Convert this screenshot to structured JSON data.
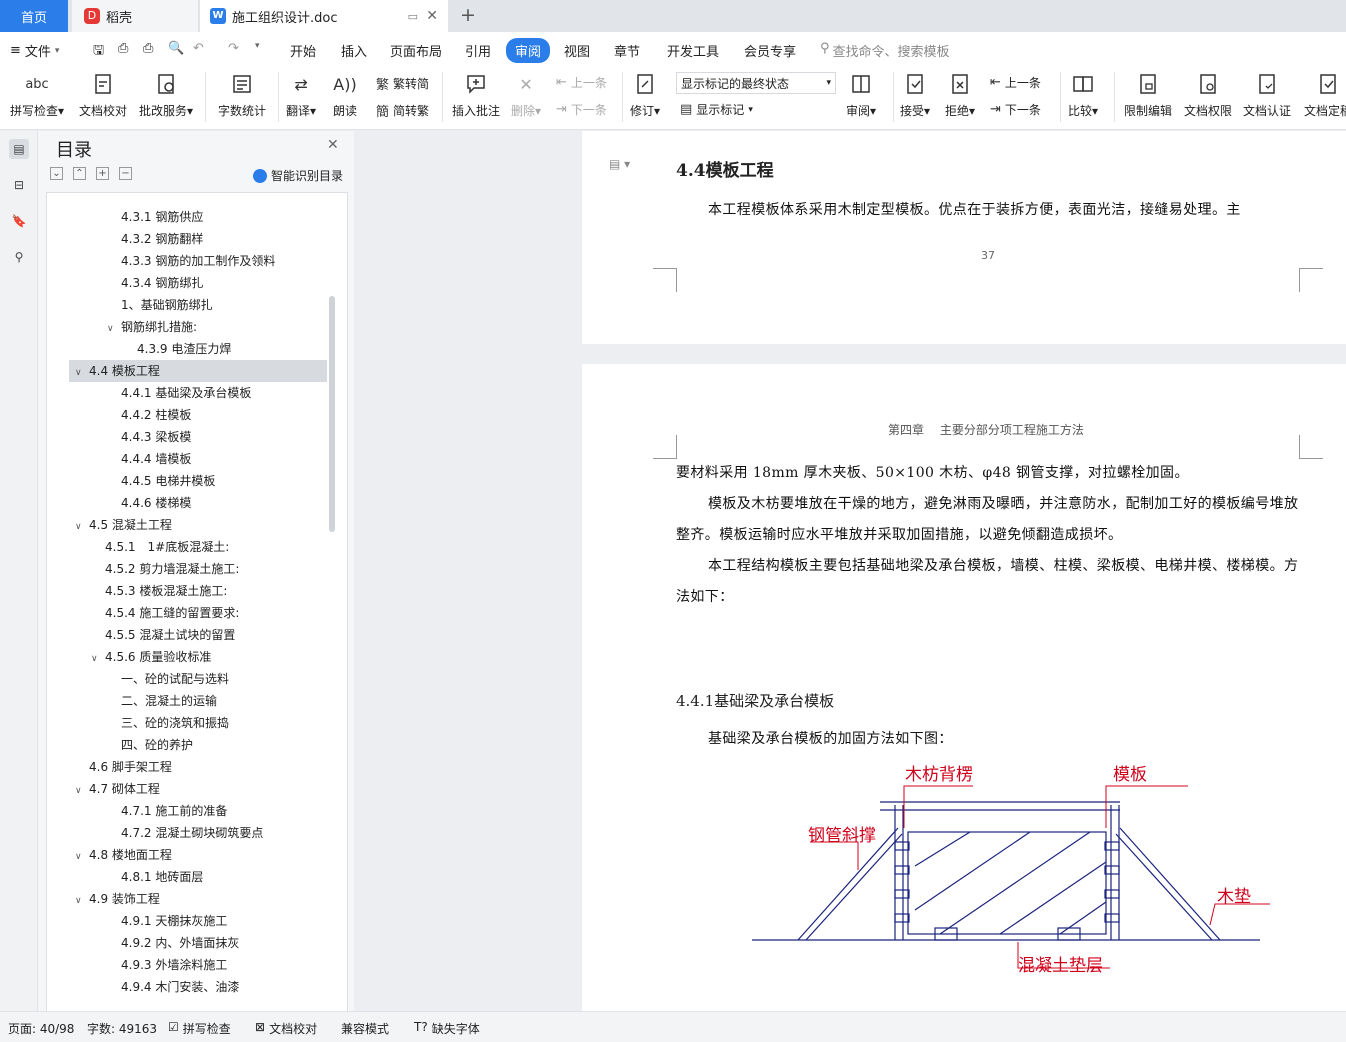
{
  "tabs": {
    "home": "首页",
    "daoke": "稻壳",
    "doc": "施工组织设计.doc",
    "new_tab": "+"
  },
  "menu": {
    "file": "文件",
    "items": [
      "开始",
      "插入",
      "页面布局",
      "引用",
      "审阅",
      "视图",
      "章节",
      "开发工具",
      "会员专享"
    ],
    "active": "审阅",
    "search": "查找命令、搜索模板"
  },
  "toolbar": {
    "spell": "拼写检查",
    "proof": "文档校对",
    "batch": "批改服务",
    "wordcount": "字数统计",
    "translate": "翻译",
    "read": "朗读",
    "t2s": "繁转简",
    "s2t": "简转繁",
    "add_comment": "插入批注",
    "delete": "删除",
    "prev_comment": "上一条",
    "next_comment": "下一条",
    "revise": "修订",
    "markup_state": "显示标记的最终状态",
    "show_markup": "显示标记",
    "review": "审阅",
    "accept": "接受",
    "reject": "拒绝",
    "prev": "上一条",
    "next": "下一条",
    "compare": "比较",
    "restrict": "限制编辑",
    "permission": "文档权限",
    "certify": "文档认证",
    "finalize": "文档定稿",
    "spell_icon_text": "abc"
  },
  "toc": {
    "title": "目录",
    "smart": "智能识别目录",
    "items": [
      {
        "text": "4.3.1 钢筋供应",
        "level": 3
      },
      {
        "text": "4.3.2 钢筋翻样",
        "level": 3
      },
      {
        "text": "4.3.3 钢筋的加工制作及领料",
        "level": 3
      },
      {
        "text": "4.3.4 钢筋绑扎",
        "level": 3
      },
      {
        "text": "1、基础钢筋绑扎",
        "level": 3
      },
      {
        "text": "钢筋绑扎措施:",
        "level": 3,
        "chev": true
      },
      {
        "text": "4.3.9 电渣压力焊",
        "level": 4
      },
      {
        "text": "4.4 模板工程",
        "level": 1,
        "chev": true,
        "selected": true
      },
      {
        "text": "4.4.1 基础梁及承台模板",
        "level": 3
      },
      {
        "text": "4.4.2 柱模板",
        "level": 3
      },
      {
        "text": "4.4.3 梁板模",
        "level": 3
      },
      {
        "text": "4.4.4 墙模板",
        "level": 3
      },
      {
        "text": "4.4.5 电梯井模板",
        "level": 3
      },
      {
        "text": "4.4.6 楼梯模",
        "level": 3
      },
      {
        "text": "4.5 混凝土工程",
        "level": 1,
        "chev": true
      },
      {
        "text": "4.5.1　1#底板混凝土:",
        "level": 2
      },
      {
        "text": "4.5.2  剪力墙混凝土施工:",
        "level": 2
      },
      {
        "text": "4.5.3  楼板混凝土施工:",
        "level": 2
      },
      {
        "text": "4.5.4  施工缝的留置要求:",
        "level": 2
      },
      {
        "text": "4.5.5  混凝土试块的留置",
        "level": 2
      },
      {
        "text": "4.5.6 质量验收标准",
        "level": 2,
        "chev": true
      },
      {
        "text": "一、砼的试配与选料",
        "level": 3
      },
      {
        "text": "二、混凝土的运输",
        "level": 3
      },
      {
        "text": "三、砼的浇筑和振捣",
        "level": 3
      },
      {
        "text": "四、砼的养护",
        "level": 3
      },
      {
        "text": "4.6  脚手架工程",
        "level": 1
      },
      {
        "text": "4.7  砌体工程",
        "level": 1,
        "chev": true
      },
      {
        "text": "4.7.1 施工前的准备",
        "level": 3
      },
      {
        "text": "4.7.2  混凝土砌块砌筑要点",
        "level": 3
      },
      {
        "text": "4.8 楼地面工程",
        "level": 1,
        "chev": true
      },
      {
        "text": "4.8.1 地砖面层",
        "level": 3
      },
      {
        "text": "4.9  装饰工程",
        "level": 1,
        "chev": true
      },
      {
        "text": "4.9.1  天棚抹灰施工",
        "level": 3
      },
      {
        "text": "4.9.2 内、外墙面抹灰",
        "level": 3
      },
      {
        "text": "4.9.3 外墙涂料施工",
        "level": 3
      },
      {
        "text": "4.9.4 木门安装、油漆",
        "level": 3
      }
    ]
  },
  "doc": {
    "heading_44": "4.4模板工程",
    "p1": "本工程模板体系采用木制定型模板。优点在于装拆方便，表面光洁，接缝易处理。主",
    "page_number": "37",
    "header_text": "第四章　 主要分部分项工程施工方法",
    "p2": "要材料采用 18mm 厚木夹板、50×100 木枋、φ48 钢管支撑，对拉螺栓加固。",
    "p3": "模板及木枋要堆放在干燥的地方，避免淋雨及曝晒，并注意防水，配制加工好的模板编号堆放整齐。模板运输时应水平堆放并采取加固措施，以避免倾翻造成损坏。",
    "p4": "本工程结构模板主要包括基础地梁及承台模板，墙模、柱模、梁板模、电梯井模、楼梯模。方法如下：",
    "heading_441": "4.4.1基础梁及承台模板",
    "p5": "基础梁及承台模板的加固方法如下图：",
    "fig": {
      "l1": "木枋背楞",
      "l2": "模板",
      "l3": "钢管斜撑",
      "l4": "木垫",
      "l5": "混凝土垫层"
    }
  },
  "status": {
    "page": "页面: 40/98",
    "words": "字数: 49163",
    "spell": "拼写检查",
    "proof": "文档校对",
    "compat": "兼容模式",
    "font": "缺失字体"
  },
  "colors": {
    "accent": "#2b7de9",
    "red": "#d0021b"
  }
}
